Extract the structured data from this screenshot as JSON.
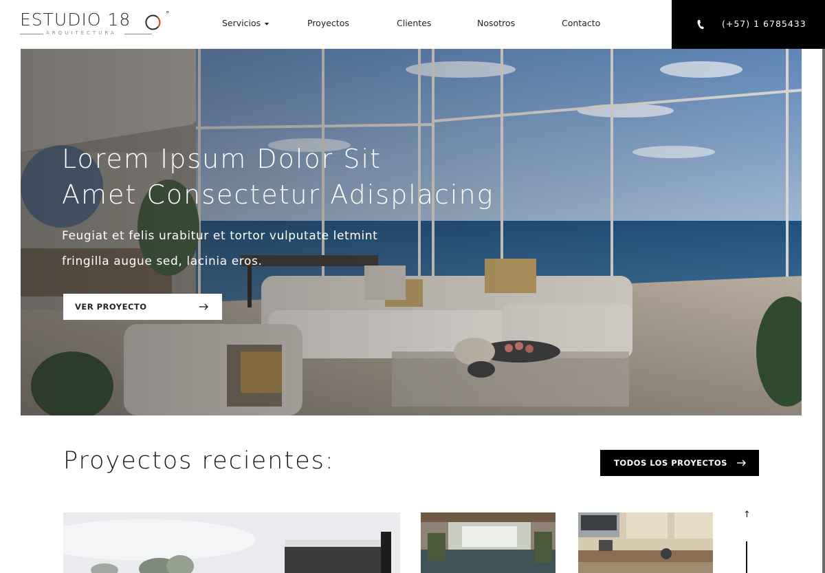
{
  "brand": {
    "name": "ESTUDIO 18",
    "degree": "°",
    "tagline": "ARQUITECTURA"
  },
  "nav": {
    "items": [
      {
        "label": "Servicios",
        "has_dropdown": true
      },
      {
        "label": "Proyectos"
      },
      {
        "label": "Clientes"
      },
      {
        "label": "Nosotros"
      },
      {
        "label": "Contacto"
      }
    ]
  },
  "contact": {
    "phone": "(+57) 1 6785433",
    "icon": "phone-icon"
  },
  "hero": {
    "title_line1": "Lorem Ipsum Dolor Sit",
    "title_line2": "Amet Consectetur Adisplacing",
    "subtitle_line1": "Feugiat et felis urabitur et tortor vulputate letmint",
    "subtitle_line2": "fringilla augue sed, lacinia eros.",
    "button_label": "VER PROYECTO"
  },
  "recent": {
    "title": "Proyectos recientes:",
    "button_label": "TODOS LOS PROYECTOS"
  },
  "colors": {
    "accent": "#000000",
    "logo_ring": "#d9342b",
    "text": "#1a1a1a"
  }
}
